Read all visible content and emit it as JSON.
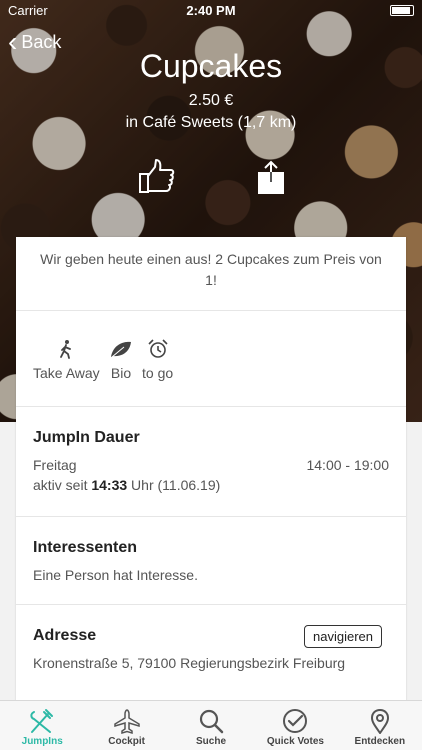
{
  "status": {
    "carrier": "Carrier",
    "time": "2:40 PM"
  },
  "nav": {
    "back_label": "Back"
  },
  "product": {
    "title": "Cupcakes",
    "price": "2.50 €",
    "location": "in Café Sweets (1,7 km)"
  },
  "promo": "Wir geben heute einen aus! 2 Cupcakes zum Preis von 1!",
  "features": [
    {
      "label": "Take Away",
      "icon": "walking-person-icon"
    },
    {
      "label": "Bio",
      "icon": "leaf-icon"
    },
    {
      "label": "to go",
      "icon": "alarm-clock-icon"
    }
  ],
  "dauer": {
    "title": "JumpIn Dauer",
    "day": "Freitag",
    "hours": "14:00 - 19:00",
    "active_prefix": "aktiv seit ",
    "active_time": "14:33",
    "active_suffix": " Uhr (11.06.19)"
  },
  "interest": {
    "title": "Interessenten",
    "text": "Eine Person hat Interesse."
  },
  "address": {
    "title": "Adresse",
    "nav_button": "navigieren",
    "text": "Kronenstraße 5, 79100 Regierungsbezirk Freiburg"
  },
  "tabs": [
    {
      "label": "JumpIns",
      "icon": "cutlery-icon",
      "active": true
    },
    {
      "label": "Cockpit",
      "icon": "airplane-icon",
      "active": false
    },
    {
      "label": "Suche",
      "icon": "search-icon",
      "active": false
    },
    {
      "label": "Quick Votes",
      "icon": "check-circle-icon",
      "active": false
    },
    {
      "label": "Entdecken",
      "icon": "location-pin-icon",
      "active": false
    }
  ],
  "colors": {
    "accent": "#2db9a6"
  }
}
